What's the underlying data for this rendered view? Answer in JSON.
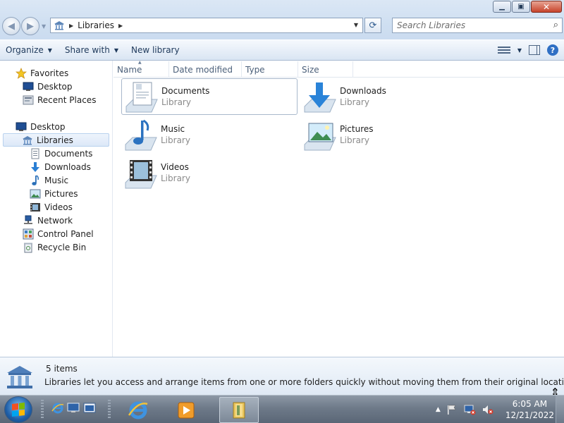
{
  "window": {
    "title_buttons": {
      "minimize": "▁",
      "maximize": "▣",
      "close": "✕"
    }
  },
  "address": {
    "crumb": "Libraries"
  },
  "search": {
    "placeholder": "Search Libraries"
  },
  "toolbar": {
    "organize": "Organize",
    "share_with": "Share with",
    "new_library": "New library"
  },
  "nav": {
    "favorites": "Favorites",
    "fav_items": [
      "Desktop",
      "Recent Places"
    ],
    "desktop": "Desktop",
    "libraries": "Libraries",
    "lib_items": [
      "Documents",
      "Downloads",
      "Music",
      "Pictures",
      "Videos"
    ],
    "network": "Network",
    "control_panel": "Control Panel",
    "recycle_bin": "Recycle Bin"
  },
  "columns": {
    "name": "Name",
    "date": "Date modified",
    "type": "Type",
    "size": "Size"
  },
  "items": [
    {
      "name": "Documents",
      "kind": "Library"
    },
    {
      "name": "Downloads",
      "kind": "Library"
    },
    {
      "name": "Music",
      "kind": "Library"
    },
    {
      "name": "Pictures",
      "kind": "Library"
    },
    {
      "name": "Videos",
      "kind": "Library"
    }
  ],
  "details": {
    "count": "5 items",
    "description": "Libraries let you access and arrange items from one or more folders quickly without moving them from their original locations."
  },
  "taskbar": {
    "time": "6:05 AM",
    "date": "12/21/2022"
  },
  "colors": {
    "accent": "#2f6fc4",
    "taskbar": "#6e7a89",
    "toolbar_text": "#1e395b"
  }
}
